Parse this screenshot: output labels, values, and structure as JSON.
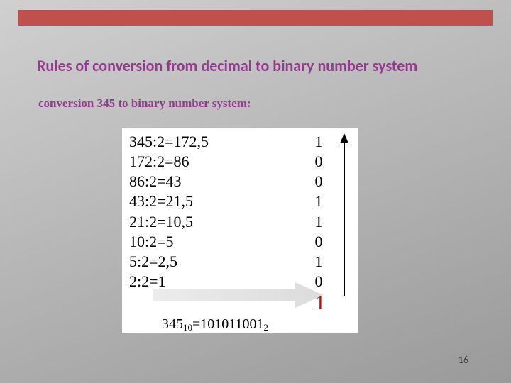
{
  "title": "Rules of conversion from decimal to binary number system",
  "subtitle": "conversion 345 to binary number system:",
  "calc": [
    {
      "lhs": "345:2=172,5",
      "bit": "1"
    },
    {
      "lhs": "172:2=86",
      "bit": "0"
    },
    {
      "lhs": "86:2=43",
      "bit": "0"
    },
    {
      "lhs": "43:2=21,5",
      "bit": "1"
    },
    {
      "lhs": "21:2=10,5",
      "bit": "1"
    },
    {
      "lhs": "10:2=5",
      "bit": "0"
    },
    {
      "lhs": "5:2=2,5",
      "bit": "1"
    },
    {
      "lhs": "2:2=1",
      "bit": "0"
    }
  ],
  "final_one": "1",
  "result": {
    "lhs_num": "345",
    "lhs_sub": "10",
    "eq": "=",
    "rhs_num": "101011001",
    "rhs_sub": "2"
  },
  "page_number": "16"
}
